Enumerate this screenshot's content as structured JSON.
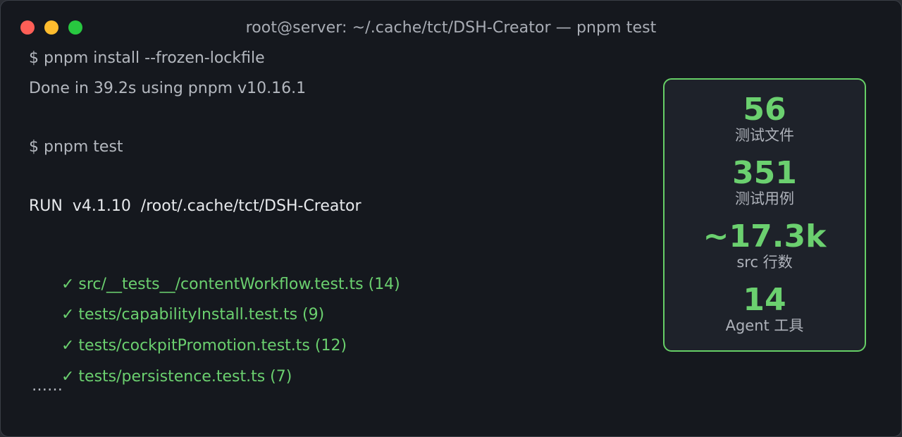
{
  "window": {
    "title": "root@server: ~/.cache/tct/DSH-Creator — pnpm test",
    "traffic_lights": {
      "close_color": "#ff5f57",
      "minimize_color": "#febc2e",
      "zoom_color": "#28c840"
    }
  },
  "terminal": {
    "lines": {
      "cmd_install": "$ pnpm install --frozen-lockfile",
      "install_done": "Done in 39.2s using pnpm v10.16.1",
      "cmd_test": "$ pnpm test",
      "run_header": " RUN  v4.1.10  /root/.cache/tct/DSH-Creator",
      "check_mark": "✓",
      "pass_1": "src/__tests__/contentWorkflow.test.ts (14)",
      "pass_2": "tests/capabilityInstall.test.ts (9)",
      "pass_3": "tests/cockpitPromotion.test.ts (12)",
      "pass_4": "tests/persistence.test.ts (7)",
      "ellipsis": "……"
    }
  },
  "stats": [
    {
      "value": "56",
      "label": "测试文件"
    },
    {
      "value": "351",
      "label": "测试用例"
    },
    {
      "value": "~17.3k",
      "label": "src 行数"
    },
    {
      "value": "14",
      "label": "Agent 工具"
    }
  ],
  "colors": {
    "accent_green": "#6bd06f",
    "background": "#15181e",
    "panel_background": "#1e222a"
  }
}
